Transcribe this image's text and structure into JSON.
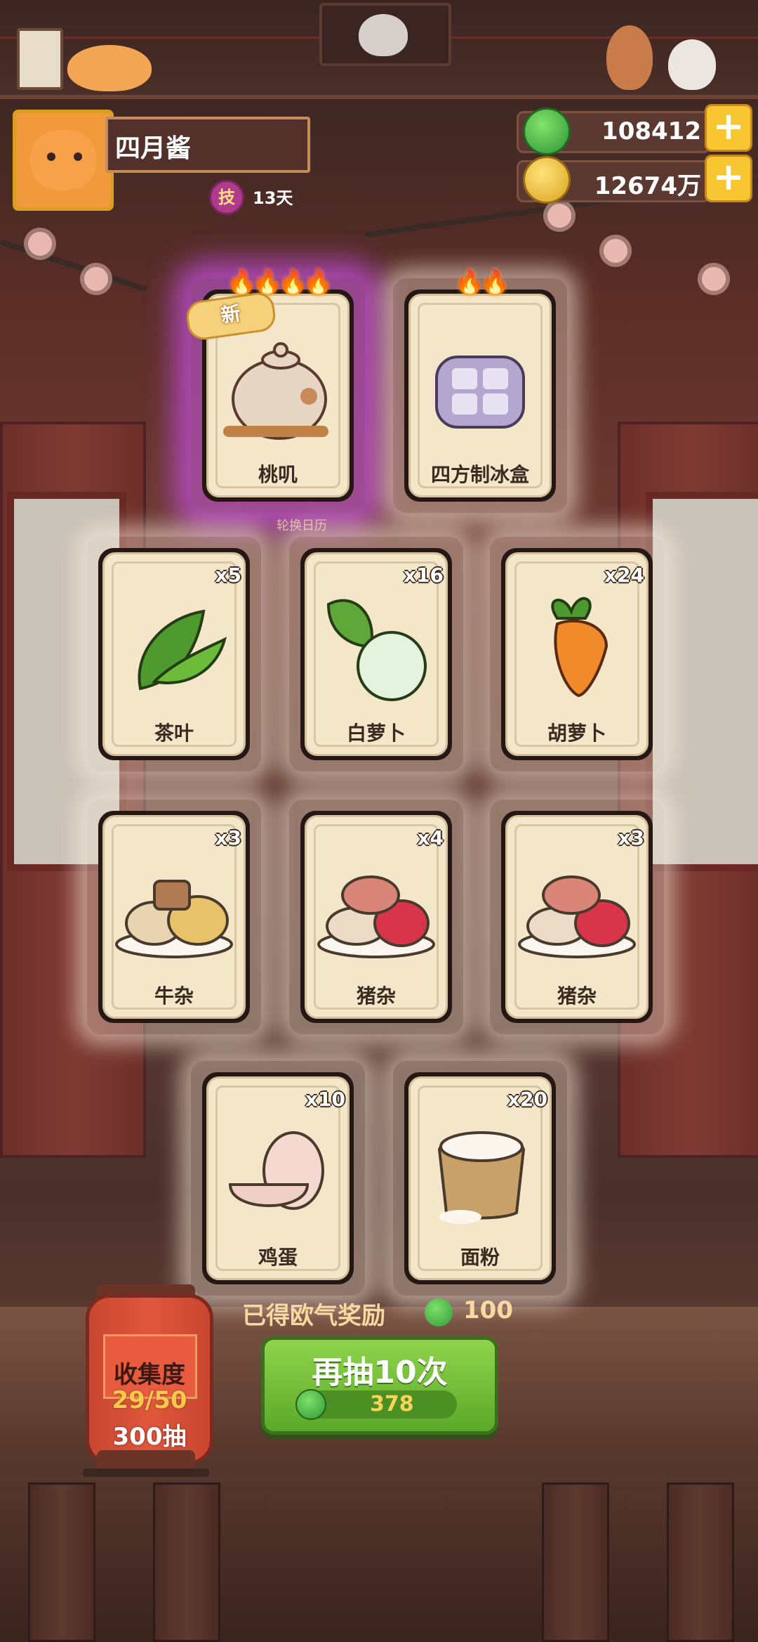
{
  "player": {
    "name": "四月酱",
    "skill_badge": "技",
    "days": "13天"
  },
  "currency": {
    "jade": "108412",
    "coins": "12674万"
  },
  "calendar_label": "轮换日历",
  "new_badge": "新",
  "cards": [
    {
      "name": "桃叽",
      "count": "",
      "flames": 4,
      "is_new": true,
      "rarity": "purple"
    },
    {
      "name": "四方制冰盒",
      "count": "",
      "flames": 2,
      "is_new": false,
      "rarity": "normal"
    },
    {
      "name": "茶叶",
      "count": "x5"
    },
    {
      "name": "白萝卜",
      "count": "x16"
    },
    {
      "name": "胡萝卜",
      "count": "x24"
    },
    {
      "name": "牛杂",
      "count": "x3"
    },
    {
      "name": "猪杂",
      "count": "x4"
    },
    {
      "name": "猪杂",
      "count": "x3"
    },
    {
      "name": "鸡蛋",
      "count": "x10"
    },
    {
      "name": "面粉",
      "count": "x20"
    }
  ],
  "reward": {
    "label": "已得欧气奖励",
    "value": "100"
  },
  "draw_button": {
    "label": "再抽10次",
    "cost": "378"
  },
  "collection": {
    "title": "收集度",
    "progress": "29/50",
    "draws": "300抽"
  },
  "colors": {
    "accent_green": "#5ba829",
    "gold": "#f7c631",
    "purple_glow": "#c850e6"
  }
}
